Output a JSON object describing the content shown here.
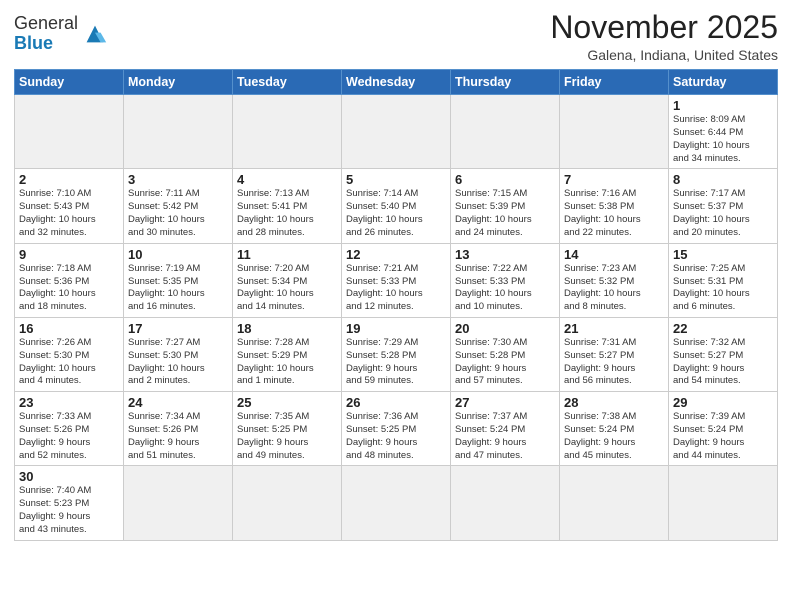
{
  "header": {
    "logo_general": "General",
    "logo_blue": "Blue",
    "month_title": "November 2025",
    "location": "Galena, Indiana, United States"
  },
  "weekdays": [
    "Sunday",
    "Monday",
    "Tuesday",
    "Wednesday",
    "Thursday",
    "Friday",
    "Saturday"
  ],
  "weeks": [
    [
      {
        "day": "",
        "info": ""
      },
      {
        "day": "",
        "info": ""
      },
      {
        "day": "",
        "info": ""
      },
      {
        "day": "",
        "info": ""
      },
      {
        "day": "",
        "info": ""
      },
      {
        "day": "",
        "info": ""
      },
      {
        "day": "1",
        "info": "Sunrise: 8:09 AM\nSunset: 6:44 PM\nDaylight: 10 hours\nand 34 minutes."
      }
    ],
    [
      {
        "day": "2",
        "info": "Sunrise: 7:10 AM\nSunset: 5:43 PM\nDaylight: 10 hours\nand 32 minutes."
      },
      {
        "day": "3",
        "info": "Sunrise: 7:11 AM\nSunset: 5:42 PM\nDaylight: 10 hours\nand 30 minutes."
      },
      {
        "day": "4",
        "info": "Sunrise: 7:13 AM\nSunset: 5:41 PM\nDaylight: 10 hours\nand 28 minutes."
      },
      {
        "day": "5",
        "info": "Sunrise: 7:14 AM\nSunset: 5:40 PM\nDaylight: 10 hours\nand 26 minutes."
      },
      {
        "day": "6",
        "info": "Sunrise: 7:15 AM\nSunset: 5:39 PM\nDaylight: 10 hours\nand 24 minutes."
      },
      {
        "day": "7",
        "info": "Sunrise: 7:16 AM\nSunset: 5:38 PM\nDaylight: 10 hours\nand 22 minutes."
      },
      {
        "day": "8",
        "info": "Sunrise: 7:17 AM\nSunset: 5:37 PM\nDaylight: 10 hours\nand 20 minutes."
      }
    ],
    [
      {
        "day": "9",
        "info": "Sunrise: 7:18 AM\nSunset: 5:36 PM\nDaylight: 10 hours\nand 18 minutes."
      },
      {
        "day": "10",
        "info": "Sunrise: 7:19 AM\nSunset: 5:35 PM\nDaylight: 10 hours\nand 16 minutes."
      },
      {
        "day": "11",
        "info": "Sunrise: 7:20 AM\nSunset: 5:34 PM\nDaylight: 10 hours\nand 14 minutes."
      },
      {
        "day": "12",
        "info": "Sunrise: 7:21 AM\nSunset: 5:33 PM\nDaylight: 10 hours\nand 12 minutes."
      },
      {
        "day": "13",
        "info": "Sunrise: 7:22 AM\nSunset: 5:33 PM\nDaylight: 10 hours\nand 10 minutes."
      },
      {
        "day": "14",
        "info": "Sunrise: 7:23 AM\nSunset: 5:32 PM\nDaylight: 10 hours\nand 8 minutes."
      },
      {
        "day": "15",
        "info": "Sunrise: 7:25 AM\nSunset: 5:31 PM\nDaylight: 10 hours\nand 6 minutes."
      }
    ],
    [
      {
        "day": "16",
        "info": "Sunrise: 7:26 AM\nSunset: 5:30 PM\nDaylight: 10 hours\nand 4 minutes."
      },
      {
        "day": "17",
        "info": "Sunrise: 7:27 AM\nSunset: 5:30 PM\nDaylight: 10 hours\nand 2 minutes."
      },
      {
        "day": "18",
        "info": "Sunrise: 7:28 AM\nSunset: 5:29 PM\nDaylight: 10 hours\nand 1 minute."
      },
      {
        "day": "19",
        "info": "Sunrise: 7:29 AM\nSunset: 5:28 PM\nDaylight: 9 hours\nand 59 minutes."
      },
      {
        "day": "20",
        "info": "Sunrise: 7:30 AM\nSunset: 5:28 PM\nDaylight: 9 hours\nand 57 minutes."
      },
      {
        "day": "21",
        "info": "Sunrise: 7:31 AM\nSunset: 5:27 PM\nDaylight: 9 hours\nand 56 minutes."
      },
      {
        "day": "22",
        "info": "Sunrise: 7:32 AM\nSunset: 5:27 PM\nDaylight: 9 hours\nand 54 minutes."
      }
    ],
    [
      {
        "day": "23",
        "info": "Sunrise: 7:33 AM\nSunset: 5:26 PM\nDaylight: 9 hours\nand 52 minutes."
      },
      {
        "day": "24",
        "info": "Sunrise: 7:34 AM\nSunset: 5:26 PM\nDaylight: 9 hours\nand 51 minutes."
      },
      {
        "day": "25",
        "info": "Sunrise: 7:35 AM\nSunset: 5:25 PM\nDaylight: 9 hours\nand 49 minutes."
      },
      {
        "day": "26",
        "info": "Sunrise: 7:36 AM\nSunset: 5:25 PM\nDaylight: 9 hours\nand 48 minutes."
      },
      {
        "day": "27",
        "info": "Sunrise: 7:37 AM\nSunset: 5:24 PM\nDaylight: 9 hours\nand 47 minutes."
      },
      {
        "day": "28",
        "info": "Sunrise: 7:38 AM\nSunset: 5:24 PM\nDaylight: 9 hours\nand 45 minutes."
      },
      {
        "day": "29",
        "info": "Sunrise: 7:39 AM\nSunset: 5:24 PM\nDaylight: 9 hours\nand 44 minutes."
      }
    ],
    [
      {
        "day": "30",
        "info": "Sunrise: 7:40 AM\nSunset: 5:23 PM\nDaylight: 9 hours\nand 43 minutes."
      },
      {
        "day": "",
        "info": ""
      },
      {
        "day": "",
        "info": ""
      },
      {
        "day": "",
        "info": ""
      },
      {
        "day": "",
        "info": ""
      },
      {
        "day": "",
        "info": ""
      },
      {
        "day": "",
        "info": ""
      }
    ]
  ]
}
